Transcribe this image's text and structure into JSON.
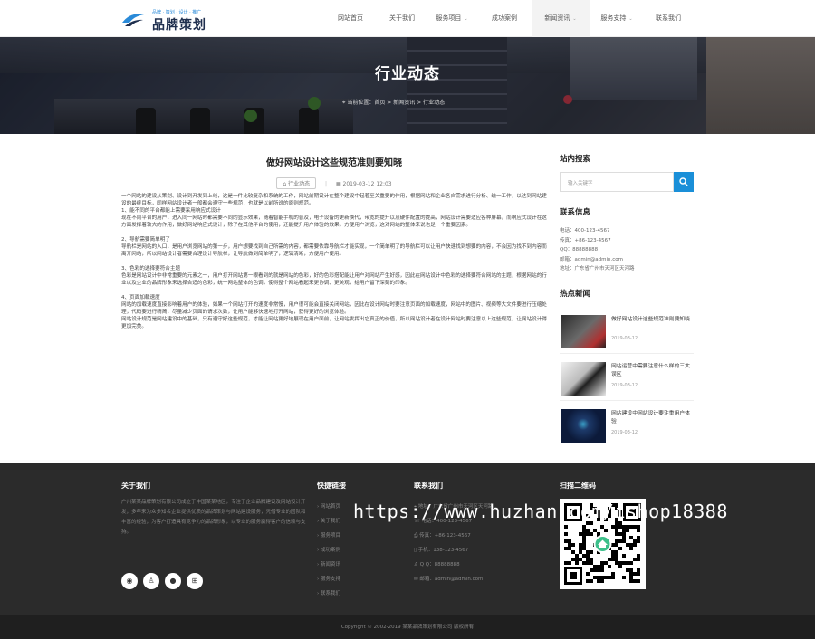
{
  "header": {
    "logo_tagline": "品牌 · 策划 · 设计 · 推广",
    "logo_name": "品牌策划",
    "nav": [
      {
        "label": "网站首页",
        "dropdown": false
      },
      {
        "label": "关于我们",
        "dropdown": false
      },
      {
        "label": "服务项目",
        "dropdown": true
      },
      {
        "label": "成功案例",
        "dropdown": false
      },
      {
        "label": "新闻资讯",
        "dropdown": true
      },
      {
        "label": "服务支持",
        "dropdown": true
      },
      {
        "label": "联系我们",
        "dropdown": false
      }
    ],
    "caret": "⌄"
  },
  "banner": {
    "title": "行业动态",
    "breadcrumb": "当前位置：首页 > 新闻资讯 > 行业动态"
  },
  "article": {
    "title": "做好网站设计这些规范准则要知晓",
    "tag": "行业动态",
    "date": "2019-03-12 12:03",
    "paragraphs": [
      "一个网站的建设从策划、设计到开发到上线，这是一件比较复杂和系统的工作，网站前期设计在整个建设中起着至关重要的作用，根据网站和企业各自需求进行分析、统一工作，以达到网站建设的最终目标，同样网站设计者一般都会遵守一些规范，也就是以前所说的原则规范。",
      "1、能不同的平台都能上需要采用响应式设计",
      "现在不同平台的用户，进入同一网站时都需要不同的显示效果，随着智能手机的普及，电子设备的更新换代，带宽的提升以及硬件配置的提高，网站设计需要适应各种屏幕，而响应式设计在这方面发挥着较大的作用，做好网站响应式设计，除了在其他平台的使用，还能提升用户体验的效果，方便用户浏览，这对网站的整体来说也是一个重要因素。",
      "2、导航需要简单明了",
      "导航栏是网站的入口，是用户浏览网站的第一步，用户想要找到自己所需的内容，都需要依靠导航栏才能实现，一个简单明了的导航栏可以让用户快速找到想要的内容，不会因为找不到内容而离开网站，所以网站设计者需要合理设计导航栏，让导航做到简单明了，逻辑清晰，方便用户使用。",
      "3、色彩的选择要符合主题",
      "色彩是网站设计中非常重要的元素之一，用户打开网站第一眼看到的就是网站的色彩，好的色彩搭配能让用户对网站产生好感，因此在网站设计中色彩的选择要符合网站的主题，根据网站的行业以及企业的品牌形象来选择合适的色彩，统一网站整体的色调，使得整个网站看起来更协调、更美观，给用户留下深刻的印象。",
      "4、页面加载速度",
      "网站的加载速度直接影响着用户的体验，如果一个网站打开的速度非常慢，用户很可能会直接关闭网站，因此在设计网站时要注意页面的加载速度，网站中的图片、视频等大文件要进行压缩处理，代码要进行精简，尽量减少页面的请求次数，让用户能够快速地打开网站，获得更好的浏览体验。",
      "网站设计规范是网站建设中的基础，只有遵守好这些规范，才能让网站更好地展现在用户面前，让网站发挥出它真正的价值，所以网站设计者在设计网站时要注意以上这些规范，让网站设计得更加完美。"
    ],
    "heading_indexes": [
      1,
      3,
      5,
      7
    ]
  },
  "sidebar": {
    "search_title": "站内搜索",
    "search_placeholder": "输入关键字",
    "contact_title": "联系信息",
    "contact": [
      "电话：400-123-4567",
      "传真：+86-123-4567",
      "QQ：88888888",
      "邮箱：admin@admin.com",
      "地址：广东省广州市天河区天河路"
    ],
    "hot_title": "热点新闻",
    "hot_news": [
      {
        "title": "做好网站设计这些规范准则要知晓",
        "date": "2019-03-12"
      },
      {
        "title": "网站运营中需要注意什么样的三大误区",
        "date": "2019-03-12"
      },
      {
        "title": "网站建设中网站设计要注重用户体验",
        "date": "2019-03-12"
      }
    ]
  },
  "footer": {
    "about_title": "关于我们",
    "about_text": "广州某某品牌策划有限公司成立于中国某某地区，专注于企业品牌建设及网站设计开发，多年来为众多知名企业提供优质的品牌策划与网站建设服务，凭借专业的团队和丰富的经验，为客户打造具有竞争力的品牌形象，以专业的服务赢得客户的信赖与支持。",
    "social_icons": [
      "weibo-icon",
      "qq-icon",
      "wechat-icon",
      "cart-icon"
    ],
    "quick_title": "快捷链接",
    "quick_links": [
      "网站首页",
      "关于我们",
      "服务项目",
      "成功案例",
      "新闻资讯",
      "服务支持",
      "联系我们"
    ],
    "contact_title": "联系我们",
    "contact_lines": [
      "地址：广东省广州市天河区天河路",
      "电话：400-123-4567",
      "传真：+86-123-4567",
      "手机：138-123-4567",
      "Q Q：88888888",
      "邮箱：admin@admin.com"
    ],
    "qr_title": "扫描二维码",
    "watermark": "https://www.huzhan.com/ishop18388",
    "copyright": "Copyright © 2002-2019 某某品牌策划有限公司 版权所有"
  },
  "colors": {
    "accent": "#1a8fd8",
    "footer_bg": "#2b2b2b",
    "copyright_bg": "#1f1f1f"
  }
}
